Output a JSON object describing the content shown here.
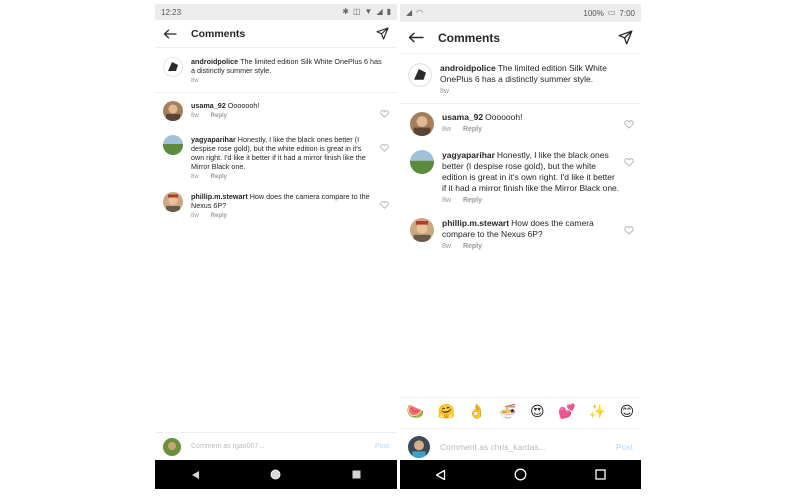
{
  "left": {
    "status": {
      "time": "12:23"
    },
    "header": {
      "title": "Comments"
    },
    "caption": {
      "username": "androidpolice",
      "text": "The limited edition Silk White OnePlus 6 has a distinctly summer style.",
      "time": "8w"
    },
    "comments": [
      {
        "username": "usama_92",
        "text": "Ooooooh!",
        "time": "8w",
        "reply": "Reply"
      },
      {
        "username": "yagyaparihar",
        "text": "Honestly, I like the black ones better (I despise rose gold), but the white edition is great in it's own right. I'd like it better if it had a mirror finish like the Mirror Black one.",
        "time": "8w",
        "reply": "Reply"
      },
      {
        "username": "phillip.m.stewart",
        "text": "How does the camera compare to the Nexus 6P?",
        "time": "8w",
        "reply": "Reply"
      }
    ],
    "composer": {
      "placeholder": "Comment as rgao007...",
      "post": "Post"
    }
  },
  "right": {
    "status": {
      "battery": "100%",
      "time": "7:00"
    },
    "header": {
      "title": "Comments"
    },
    "caption": {
      "username": "androidpolice",
      "text": "The limited edition Silk White OnePlus 6 has a distinctly summer style.",
      "time": "8w"
    },
    "comments": [
      {
        "username": "usama_92",
        "text": "Ooooooh!",
        "time": "8w",
        "reply": "Reply"
      },
      {
        "username": "yagyaparihar",
        "text": "Honestly, I like the black ones better (I despise rose gold), but the white edition is great in it's own right. I'd like it better if it had a mirror finish like the Mirror Black one.",
        "time": "8w",
        "reply": "Reply"
      },
      {
        "username": "phillip.m.stewart",
        "text": "How does the camera compare to the Nexus 6P?",
        "time": "8w",
        "reply": "Reply"
      }
    ],
    "emojis": [
      "🍉",
      "🤗",
      "👌",
      "🍜",
      "😍",
      "💕",
      "✨",
      "😊"
    ],
    "composer": {
      "placeholder": "Comment as chris_kardas...",
      "post": "Post"
    }
  },
  "icons": {
    "back": "back-arrow-icon",
    "direct": "send-icon",
    "like": "heart-icon",
    "nav_back": "nav-back-triangle-icon",
    "nav_home": "nav-home-circle-icon",
    "nav_recents": "nav-recents-square-icon"
  }
}
